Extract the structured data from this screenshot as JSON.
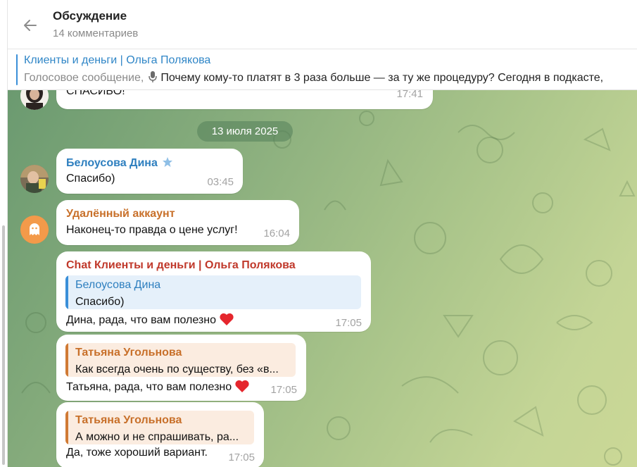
{
  "header": {
    "title": "Обсуждение",
    "subtitle": "14 комментариев"
  },
  "pinned": {
    "title": "Клиенты и деньги | Ольга Полякова",
    "kind": "Голосовое сообщение,",
    "text": "Почему кому-то платят в 3 раза больше — за ту же процедуру?  Сегодня в подкасте,"
  },
  "messages": {
    "m0": {
      "text": "СПАСИБО!",
      "time": "17:41"
    },
    "date": "13 июля 2025",
    "m1": {
      "sender": "Белоусова Дина",
      "text": "Спасибо)",
      "time": "03:45"
    },
    "m2": {
      "sender": "Удалённый аккаунт",
      "text": "Наконец-то правда о цене услуг!",
      "time": "16:04"
    },
    "m3": {
      "sender": "Chat Клиенты и деньги | Ольга Полякова",
      "quote_name": "Белоусова Дина",
      "quote_text": "Спасибо)",
      "text": "Дина, рада, что вам полезно",
      "time": "17:05"
    },
    "m4": {
      "quote_name": "Татьяна Угольнова",
      "quote_text": "Как всегда очень по существу, без «в...",
      "text": "Татьяна, рада, что вам полезно",
      "time": "17:05"
    },
    "m5": {
      "quote_name": "Татьяна Угольнова",
      "quote_text": "А можно и не спрашивать, ра...",
      "text": "Да, тоже хороший вариант.",
      "time": "17:05"
    }
  },
  "colors": {
    "accent": "#2f86c7",
    "sender_blue": "#2e7fbf",
    "sender_orange": "#c8702a",
    "sender_red": "#c0392b",
    "quote_blue_bg": "#e5f0fa",
    "quote_orange_bg": "#fbece0"
  },
  "icons": {
    "back": "arrow-left-icon",
    "mic": "microphone-icon",
    "star": "star-icon",
    "heart": "red-heart-emoji",
    "ghost": "ghost-icon"
  }
}
